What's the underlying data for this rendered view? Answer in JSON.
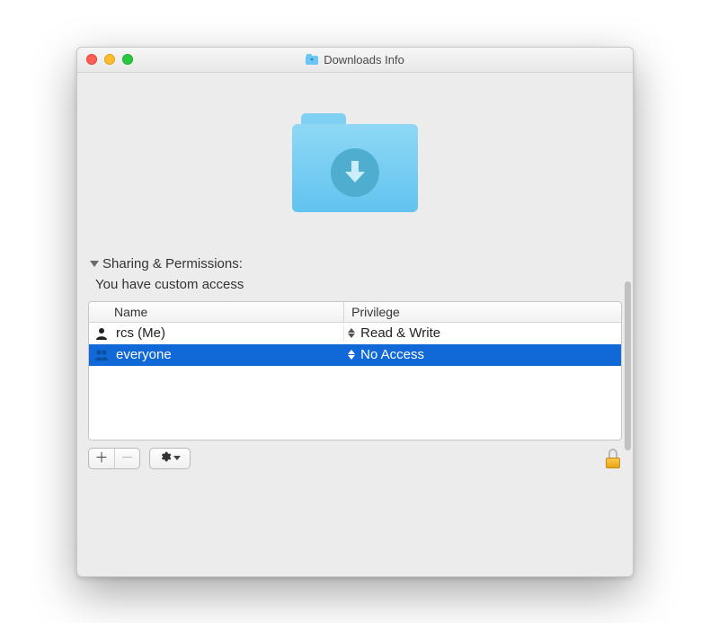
{
  "window": {
    "title": "Downloads Info"
  },
  "folder": {
    "name": "Downloads"
  },
  "section": {
    "title": "Sharing & Permissions:",
    "access_text": "You have custom access"
  },
  "table": {
    "headers": {
      "name": "Name",
      "privilege": "Privilege"
    },
    "rows": [
      {
        "icon": "user",
        "name": "rcs (Me)",
        "privilege": "Read & Write",
        "selected": false
      },
      {
        "icon": "group",
        "name": "everyone",
        "privilege": "No Access",
        "selected": true
      }
    ]
  },
  "footer": {
    "add_enabled": true,
    "remove_enabled": false,
    "locked": true
  }
}
